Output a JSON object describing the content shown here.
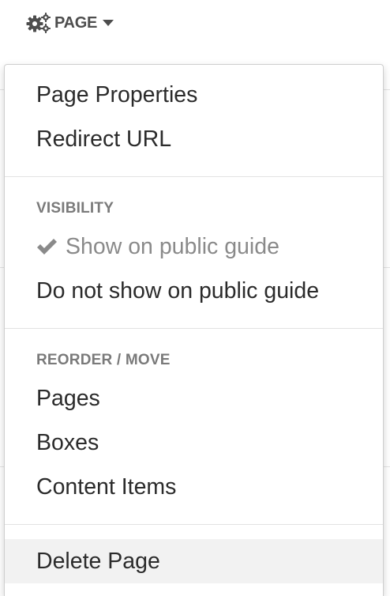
{
  "toolbar": {
    "page_label": "PAGE"
  },
  "menu": {
    "items": {
      "page_properties": "Page Properties",
      "redirect_url": "Redirect URL",
      "show_public": "Show on public guide",
      "do_not_show_public": "Do not show on public guide",
      "pages": "Pages",
      "boxes": "Boxes",
      "content_items": "Content Items",
      "delete_page": "Delete Page"
    },
    "sections": {
      "visibility": "VISIBILITY",
      "reorder_move": "REORDER / MOVE"
    }
  },
  "colors": {
    "text": "#2b2b2b",
    "muted_text": "#8a8a8a",
    "header_text": "#7a7a7a",
    "divider": "#e2e2e2",
    "hover_bg": "#f2f2f2",
    "link_blue": "#3a6ea8"
  }
}
